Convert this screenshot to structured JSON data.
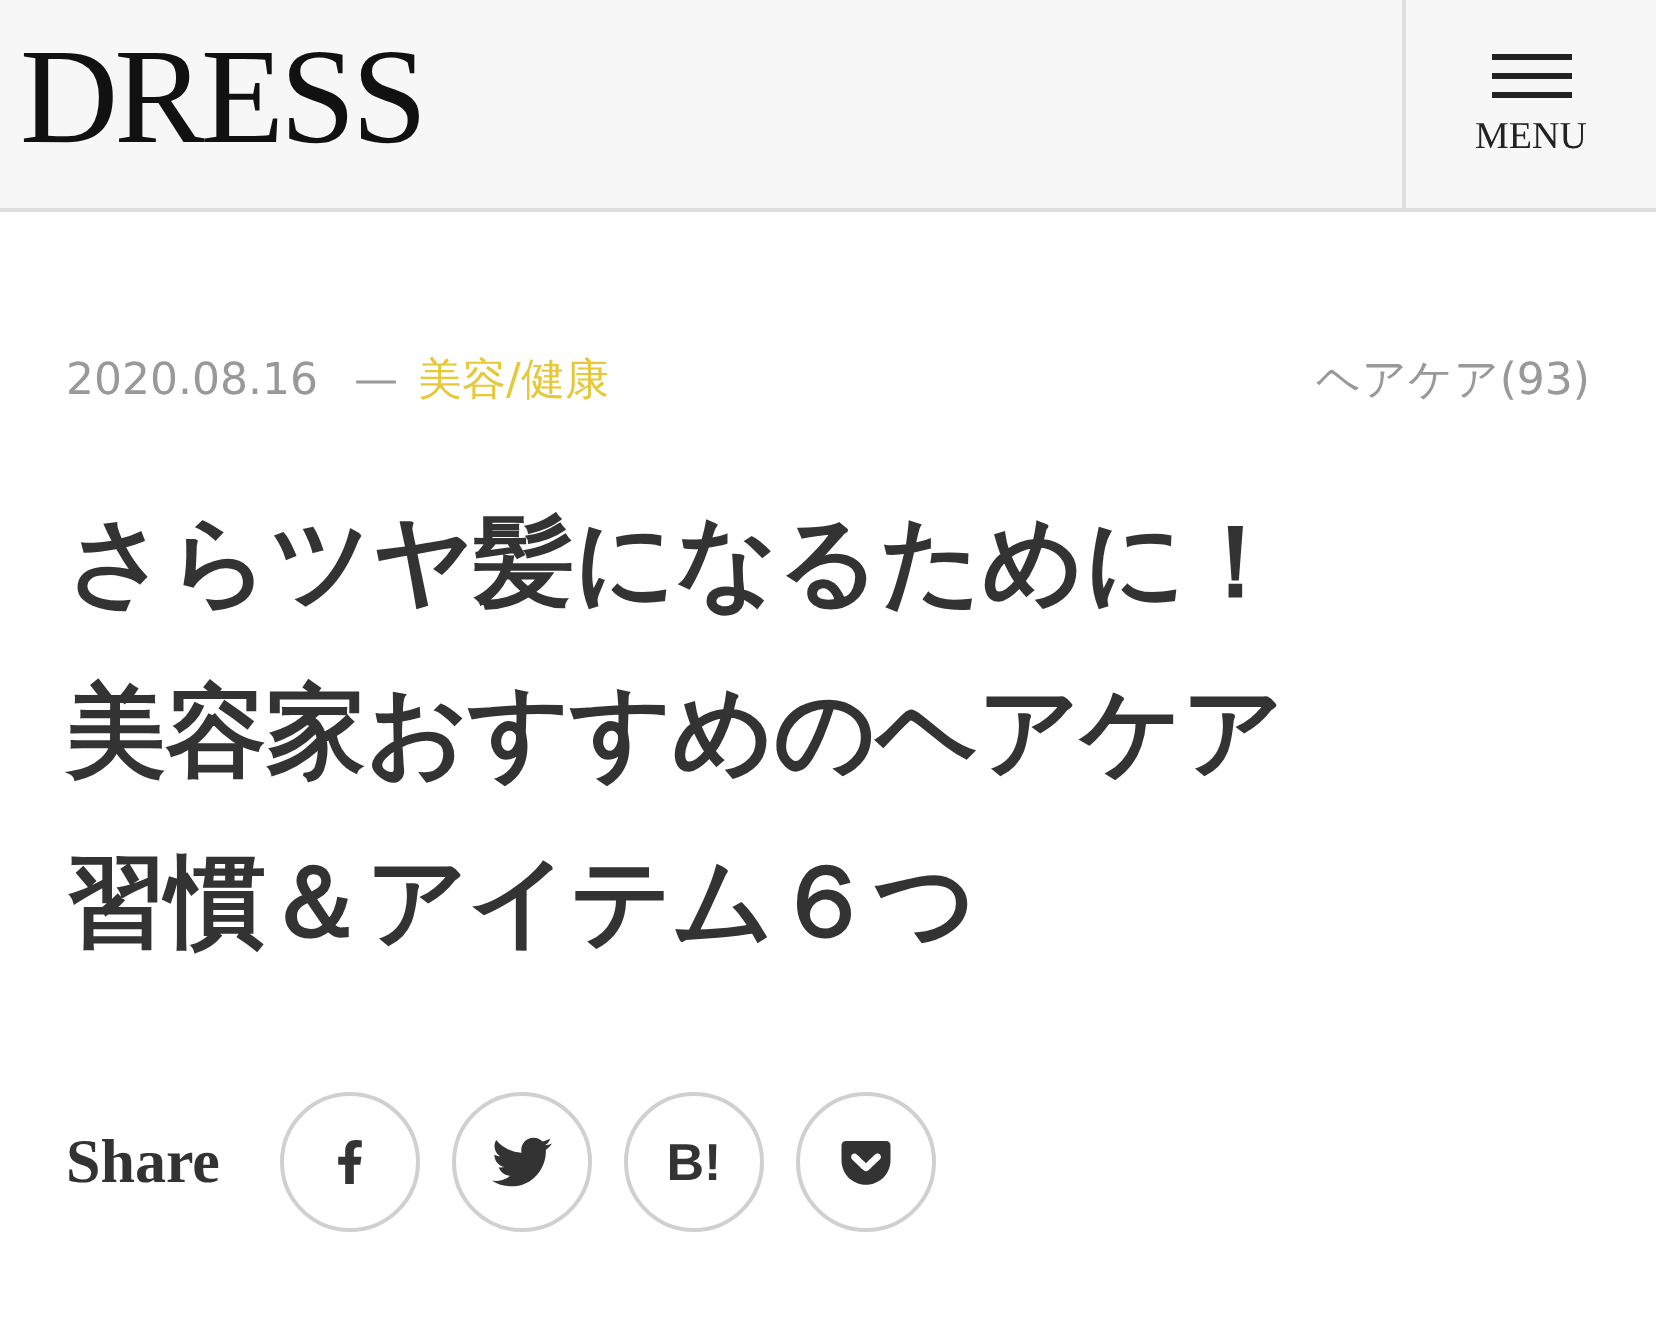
{
  "header": {
    "logo": "DRESS",
    "menu_label": "MENU"
  },
  "meta": {
    "date": "2020.08.16",
    "separator": "—",
    "category": "美容/健康",
    "tag": "ヘアケア(93)"
  },
  "title": "さらツヤ髪になるために！美容家おすすめのヘアケア習慣＆アイテム６つ",
  "share": {
    "label": "Share",
    "buttons": [
      {
        "kind": "facebook"
      },
      {
        "kind": "twitter"
      },
      {
        "kind": "hatena",
        "text": "B!"
      },
      {
        "kind": "pocket"
      }
    ]
  }
}
